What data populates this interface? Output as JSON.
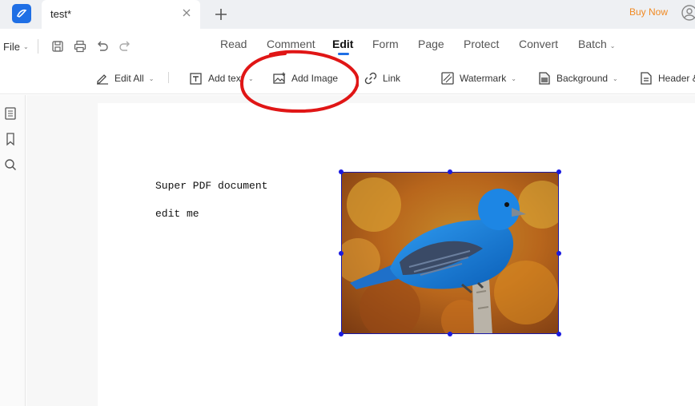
{
  "titlebar": {
    "tab_title": "test*",
    "buy_now": "Buy Now"
  },
  "menu": {
    "file": "File",
    "tabs": [
      "Read",
      "Comment",
      "Edit",
      "Form",
      "Page",
      "Protect",
      "Convert",
      "Batch"
    ],
    "active_tab": "Edit"
  },
  "toolbar": {
    "edit_all": "Edit All",
    "add_text": "Add text",
    "add_image": "Add Image",
    "link": "Link",
    "watermark": "Watermark",
    "background": "Background",
    "header_footer": "Header &"
  },
  "document": {
    "line1": "Super PDF document",
    "line2": "edit me"
  },
  "colors": {
    "accent": "#1f6fe5",
    "buy_now": "#f08a24",
    "selection": "#1a1ae0",
    "annotation": "#e01616"
  }
}
